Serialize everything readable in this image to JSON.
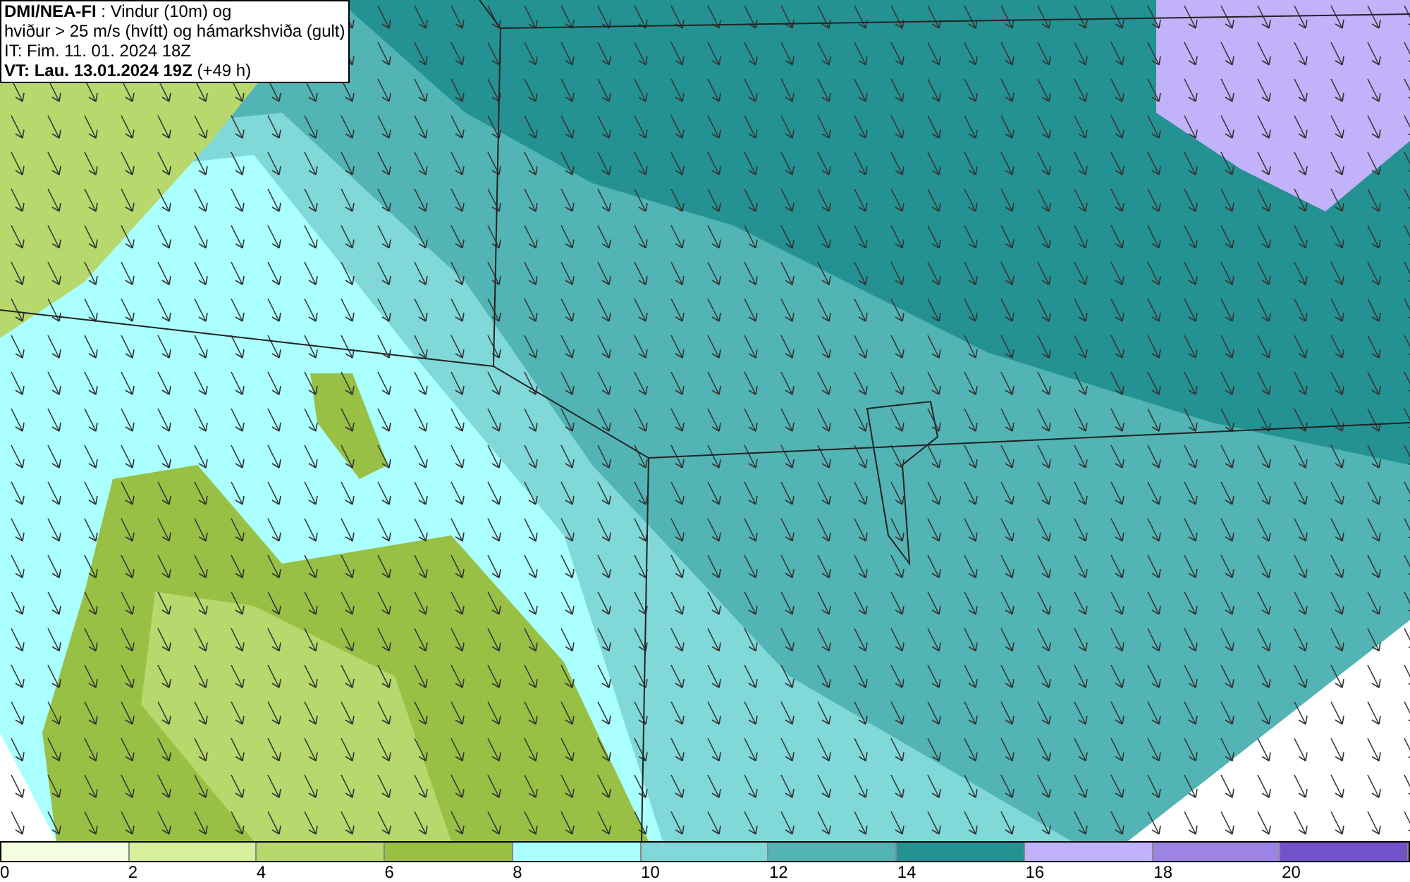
{
  "header": {
    "lines": [
      "**DMI/NEA-FI** : Vindur (10m) og",
      "hviður > 25 m/s (hvítt) og hámarkshviða (gult)",
      "IT: Fim. 11. 01. 2024 18Z",
      "**VT: Lau. 13.01.2024 19Z** (+49 h)"
    ]
  },
  "legend": [
    {
      "label": "0",
      "color": "#f5fde0"
    },
    {
      "label": "2",
      "color": "#d6f09c"
    },
    {
      "label": "4",
      "color": "#b6d86c"
    },
    {
      "label": "6",
      "color": "#98c044"
    },
    {
      "label": "8",
      "color": "#aaffff"
    },
    {
      "label": "10",
      "color": "#80d8d8"
    },
    {
      "label": "12",
      "color": "#52b4b4"
    },
    {
      "label": "14",
      "color": "#249292"
    },
    {
      "label": "16",
      "color": "#c2b2fa"
    },
    {
      "label": "18",
      "color": "#9c84e4"
    },
    {
      "label": "20",
      "color": "#7252c8"
    }
  ]
}
